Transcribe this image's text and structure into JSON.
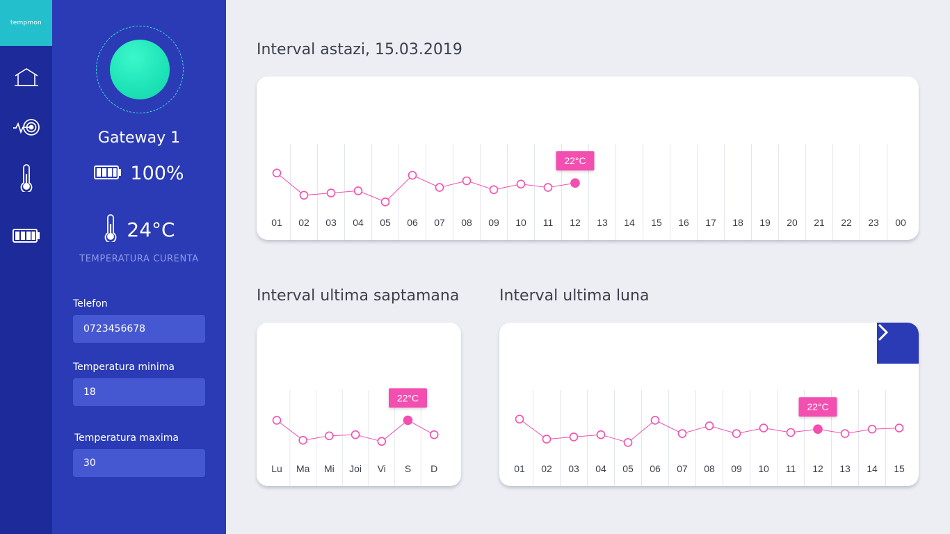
{
  "app": {
    "brand": "tempmon"
  },
  "rail": {
    "items": [
      {
        "name": "home-icon"
      },
      {
        "name": "sensor-signal-icon"
      },
      {
        "name": "thermometer-icon"
      },
      {
        "name": "battery-icon"
      }
    ]
  },
  "device": {
    "name": "Gateway 1",
    "battery": "100%",
    "temperature": "24°C",
    "temperature_caption": "TEMPERATURA CURENTA",
    "status_color": "#1de3b6"
  },
  "form": {
    "phone_label": "Telefon",
    "phone_value": "0723456678",
    "min_label": "Temperatura minima",
    "min_value": "18",
    "max_label": "Temperatura maxima",
    "max_value": "30"
  },
  "sections": {
    "today_title": "Interval astazi, 15.03.2019",
    "week_title": "Interval ultima saptamana",
    "month_title": "Interval ultima luna"
  },
  "colors": {
    "accent": "#f24fb0",
    "sidebar": "#2b3bb5",
    "rail": "#1d2a9a"
  },
  "chart_data": [
    {
      "type": "line",
      "id": "today",
      "categories": [
        "01",
        "02",
        "03",
        "04",
        "05",
        "06",
        "07",
        "08",
        "09",
        "10",
        "11",
        "12",
        "13",
        "14",
        "15",
        "16",
        "17",
        "18",
        "19",
        "20",
        "21",
        "22",
        "23",
        "00"
      ],
      "values": [
        22.2,
        20.2,
        20.4,
        20.6,
        19.6,
        22.0,
        20.9,
        21.5,
        20.7,
        21.2,
        20.9,
        21.3
      ],
      "highlight_index": 11,
      "highlight_label": "22°C",
      "ylim": [
        17,
        27
      ]
    },
    {
      "type": "line",
      "id": "week",
      "categories": [
        "Lu",
        "Ma",
        "Mi",
        "Joi",
        "Vi",
        "S",
        "D"
      ],
      "values": [
        22.1,
        20.3,
        20.7,
        20.8,
        20.2,
        22.1,
        20.8
      ],
      "highlight_index": 5,
      "highlight_label": "22°C",
      "ylim": [
        17,
        27
      ]
    },
    {
      "type": "line",
      "id": "month",
      "categories": [
        "01",
        "02",
        "03",
        "04",
        "05",
        "06",
        "07",
        "08",
        "09",
        "10",
        "11",
        "12",
        "13",
        "14",
        "15"
      ],
      "values": [
        22.2,
        20.4,
        20.6,
        20.8,
        20.1,
        22.1,
        20.9,
        21.6,
        20.9,
        21.4,
        21.0,
        21.3,
        20.9,
        21.3,
        21.4
      ],
      "highlight_index": 11,
      "highlight_label": "22°C",
      "ylim": [
        17,
        27
      ]
    }
  ]
}
